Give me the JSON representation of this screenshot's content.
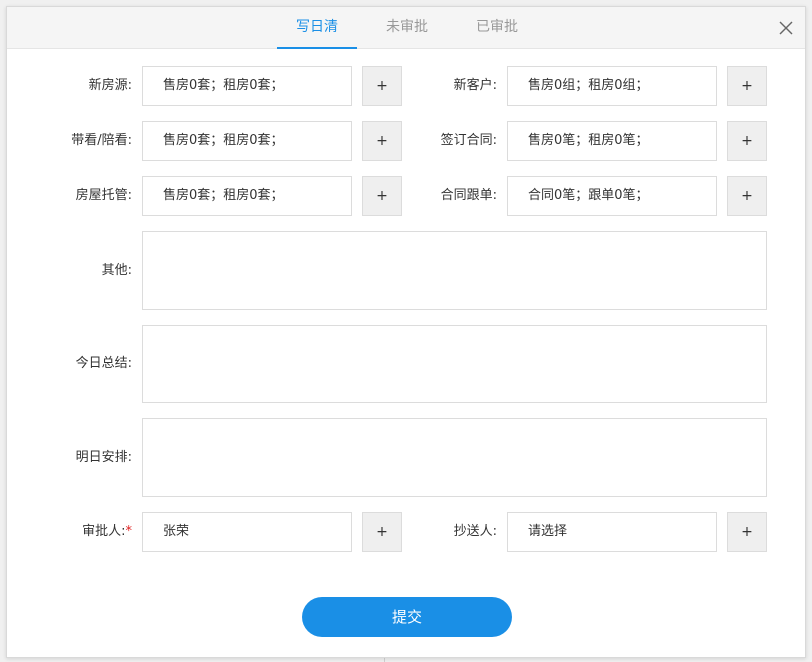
{
  "tabs": [
    {
      "label": "写日清"
    },
    {
      "label": "未审批"
    },
    {
      "label": "已审批"
    }
  ],
  "rows": [
    {
      "left": {
        "label": "新房源:",
        "value": "售房0套；租房0套；"
      },
      "right": {
        "label": "新客户:",
        "value": "售房0组；租房0组；"
      }
    },
    {
      "left": {
        "label": "带看/陪看:",
        "value": "售房0套；租房0套；"
      },
      "right": {
        "label": "签订合同:",
        "value": "售房0笔；租房0笔；"
      }
    },
    {
      "left": {
        "label": "房屋托管:",
        "value": "售房0套；租房0套；"
      },
      "right": {
        "label": "合同跟单:",
        "value": "合同0笔；跟单0笔；"
      }
    }
  ],
  "add_label": "+",
  "textareas": {
    "other": {
      "label": "其他:"
    },
    "today": {
      "label": "今日总结:"
    },
    "tomorrow": {
      "label": "明日安排:"
    }
  },
  "approver": {
    "label": "审批人:",
    "required_mark": "*",
    "value": "张荣"
  },
  "cc": {
    "label": "抄送人:",
    "value": "请选择"
  },
  "submit_label": "提交",
  "colors": {
    "accent": "#1a8fe6",
    "required": "#e02020"
  }
}
